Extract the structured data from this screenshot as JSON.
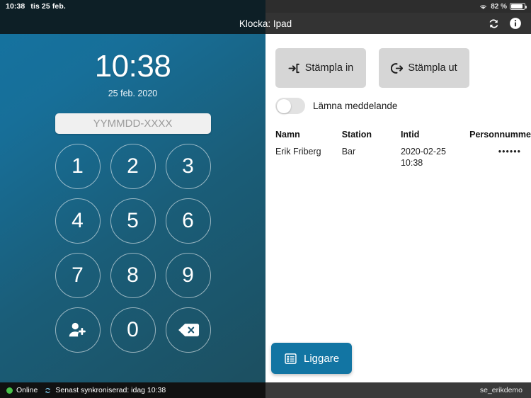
{
  "status_bar": {
    "time": "10:38",
    "date": "tis 25 feb.",
    "battery_percent": "82 %",
    "wifi_icon": "wifi-icon",
    "battery_icon": "battery-icon"
  },
  "title_bar": {
    "title": "Klocka: Ipad",
    "sync_icon": "sync-refresh-icon",
    "info_icon": "info-circle-icon"
  },
  "left_panel": {
    "clock_time": "10:38",
    "clock_date": "25 feb. 2020",
    "pin_input": {
      "value": "",
      "placeholder": "YYMMDD-XXXX"
    },
    "keys": [
      {
        "label": "1",
        "name": "key-1",
        "icon": null
      },
      {
        "label": "2",
        "name": "key-2",
        "icon": null
      },
      {
        "label": "3",
        "name": "key-3",
        "icon": null
      },
      {
        "label": "4",
        "name": "key-4",
        "icon": null
      },
      {
        "label": "5",
        "name": "key-5",
        "icon": null
      },
      {
        "label": "6",
        "name": "key-6",
        "icon": null
      },
      {
        "label": "7",
        "name": "key-7",
        "icon": null
      },
      {
        "label": "8",
        "name": "key-8",
        "icon": null
      },
      {
        "label": "9",
        "name": "key-9",
        "icon": null
      },
      {
        "label": "",
        "name": "key-add-person",
        "icon": "person-add-icon"
      },
      {
        "label": "0",
        "name": "key-0",
        "icon": null
      },
      {
        "label": "",
        "name": "key-backspace",
        "icon": "backspace-icon"
      }
    ]
  },
  "right_panel": {
    "stamp_in_label": "Stämpla in",
    "stamp_in_icon": "sign-in-arrow-icon",
    "stamp_out_label": "Stämpla ut",
    "stamp_out_icon": "sign-out-arrow-icon",
    "message_toggle": {
      "label": "Lämna meddelande",
      "state": "off"
    },
    "table": {
      "headers": [
        "Namn",
        "Station",
        "Intid",
        "Personnummer"
      ],
      "rows": [
        {
          "namn": "Erik Friberg",
          "station": "Bar",
          "intid": "2020-02-25\n10:38",
          "personnummer": "••••••"
        }
      ]
    },
    "liggare_button": {
      "label": "Liggare",
      "icon": "list-table-icon"
    }
  },
  "footer": {
    "online_status": "Online",
    "online_dot_color": "#49c24a",
    "sync_icon": "sync-small-icon",
    "sync_text": "Senast synkroniserad: idag 10:38",
    "account": "se_erikdemo"
  },
  "colors": {
    "panel_gradient_start": "#15729f",
    "panel_gradient_end": "#1c4f60",
    "accent": "#1275a3",
    "button_grey": "#d6d6d6",
    "title_bar_dark": "#333333"
  }
}
